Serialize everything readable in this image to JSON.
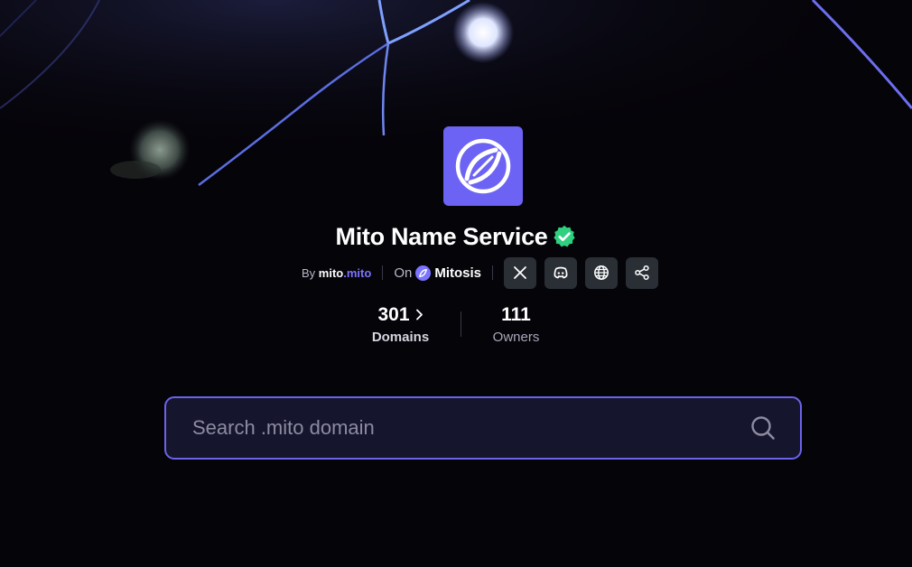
{
  "collection": {
    "title": "Mito Name Service",
    "by_label": "By",
    "creator_name": "mito",
    "creator_tld": ".mito",
    "on_label": "On",
    "chain_name": "Mitosis"
  },
  "social_icons": [
    "x-icon",
    "discord-icon",
    "globe-icon",
    "share-icon"
  ],
  "stats": {
    "domains_value": "301",
    "domains_label": "Domains",
    "owners_value": "111",
    "owners_label": "Owners"
  },
  "search": {
    "placeholder": "Search .mito domain"
  },
  "colors": {
    "background": "#050409",
    "accent": "#6c63f4",
    "search_border": "#6b63ea",
    "verified": "#2fd180"
  }
}
